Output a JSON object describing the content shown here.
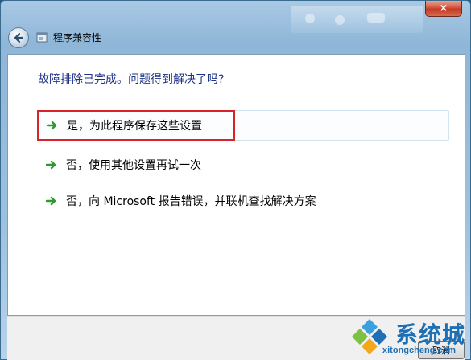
{
  "window": {
    "title": "程序兼容性",
    "close_label": "×"
  },
  "content": {
    "question": "故障排除已完成。问题得到解决了吗?",
    "options": [
      {
        "label": "是，为此程序保存这些设置"
      },
      {
        "label": "否，使用其他设置再试一次"
      },
      {
        "label": "否，向 Microsoft 报告错误，并联机查找解决方案"
      }
    ]
  },
  "footer": {
    "cancel_label": "取消"
  },
  "watermark": {
    "brand": "系统城",
    "url": "xitongcheng.com"
  },
  "colors": {
    "question_text": "#1e3287",
    "highlight_border": "#d8232a",
    "arrow_green": "#2e9a2e",
    "watermark_blue": "#1e6fb3"
  }
}
